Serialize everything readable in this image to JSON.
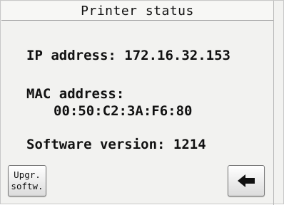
{
  "header": {
    "title": "Printer status"
  },
  "info": {
    "ip_line": "IP address: 172.16.32.153",
    "mac_label": "MAC address:",
    "mac_value": "00:50:C2:3A:F6:80",
    "software_line": "Software version: 1214"
  },
  "buttons": {
    "upgrade_line1": "Upgr.",
    "upgrade_line2": "softw.",
    "back_icon": "left-arrow-icon"
  }
}
